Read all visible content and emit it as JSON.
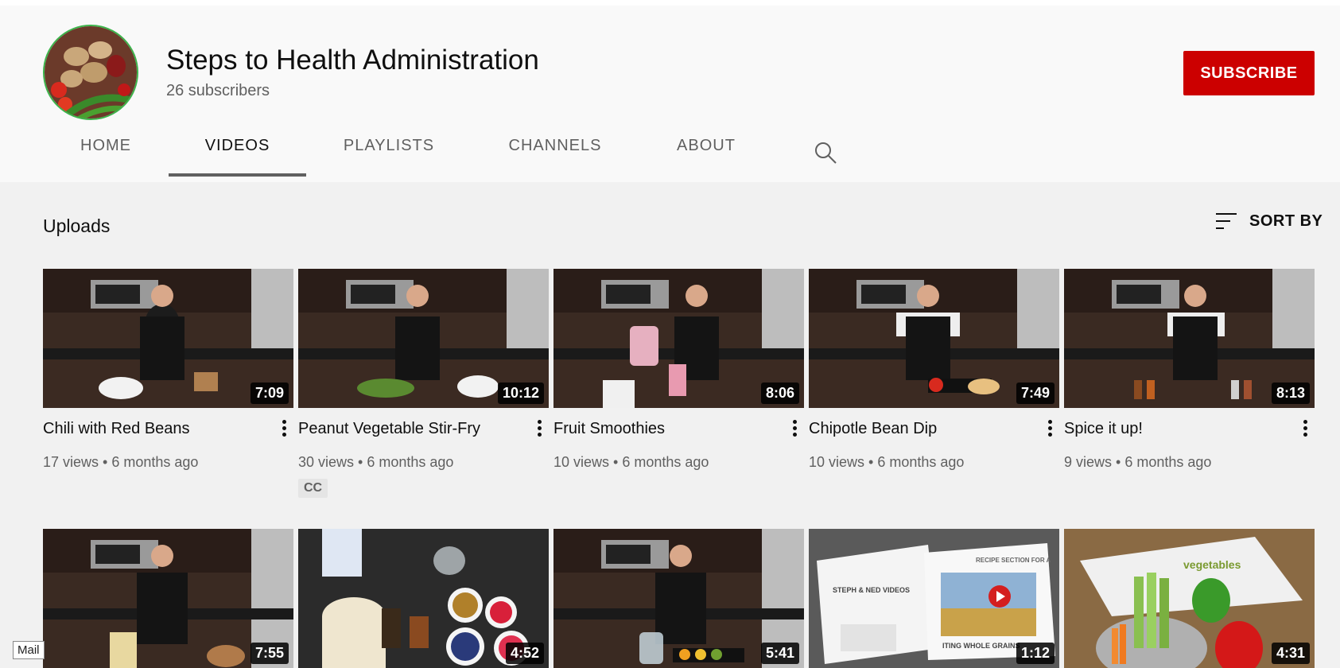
{
  "channel": {
    "title": "Steps to Health Administration",
    "subscribers": "26 subscribers",
    "subscribe_label": "SUBSCRIBE"
  },
  "tabs": [
    {
      "label": "HOME",
      "active": false
    },
    {
      "label": "VIDEOS",
      "active": true
    },
    {
      "label": "PLAYLISTS",
      "active": false
    },
    {
      "label": "CHANNELS",
      "active": false
    },
    {
      "label": "ABOUT",
      "active": false
    }
  ],
  "section": {
    "title": "Uploads",
    "sort_label": "SORT BY"
  },
  "videos": [
    {
      "title": "Chili with Red Beans",
      "views": "17 views",
      "age": "6 months ago",
      "duration": "7:09"
    },
    {
      "title": "Peanut Vegetable Stir-Fry",
      "views": "30 views",
      "age": "6 months ago",
      "duration": "10:12",
      "badge": "CC"
    },
    {
      "title": "Fruit Smoothies",
      "views": "10 views",
      "age": "6 months ago",
      "duration": "8:06"
    },
    {
      "title": "Chipotle Bean Dip",
      "views": "10 views",
      "age": "6 months ago",
      "duration": "7:49"
    },
    {
      "title": "Spice it up!",
      "views": "9 views",
      "age": "6 months ago",
      "duration": "8:13"
    },
    {
      "duration": "7:55"
    },
    {
      "duration": "4:52"
    },
    {
      "duration": "5:41"
    },
    {
      "duration": "1:12"
    },
    {
      "duration": "4:31"
    }
  ],
  "thumb_text": {
    "t9_heading": "STEPH & NED VIDEOS",
    "t9_caption": "ITING WHOLE GRAINS",
    "t9_recipe": "RECIPE SECTION FOR A",
    "t10_bag": "vegetables"
  },
  "tooltip": "Mail",
  "colors": {
    "subscribe_red": "#cc0000",
    "text_primary": "#0f0f0f",
    "text_secondary": "#606060"
  }
}
